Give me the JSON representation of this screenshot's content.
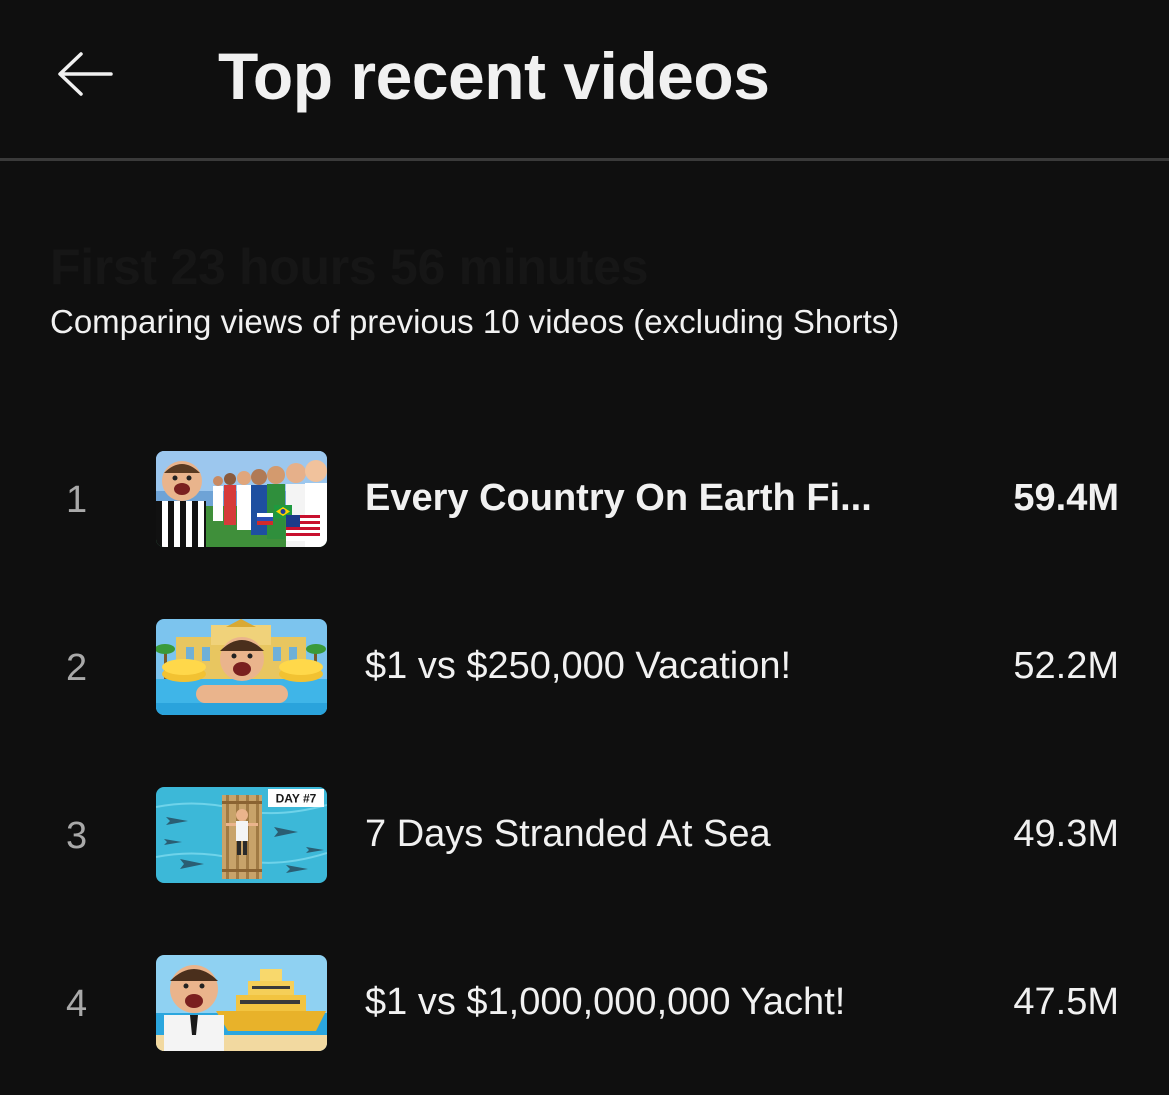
{
  "header": {
    "back_icon": "arrow-left-icon",
    "title": "Top recent videos"
  },
  "section": {
    "title": "First 23 hours 56 minutes",
    "subtitle": "Comparing views of previous 10 videos (excluding Shorts)"
  },
  "videos": [
    {
      "rank": "1",
      "title": "Every Country On Earth Fi...",
      "views": "59.4M"
    },
    {
      "rank": "2",
      "title": "$1 vs $250,000 Vacation!",
      "views": "52.2M"
    },
    {
      "rank": "3",
      "title": "7 Days Stranded At Sea",
      "views": "49.3M",
      "thumb_badge": "DAY #7"
    },
    {
      "rank": "4",
      "title": "$1 vs $1,000,000,000 Yacht!",
      "views": "47.5M"
    }
  ],
  "colors": {
    "background": "#0f0f0f",
    "text": "#f1f1f1",
    "muted": "#a9a9a9",
    "divider": "#3a3a3a"
  }
}
